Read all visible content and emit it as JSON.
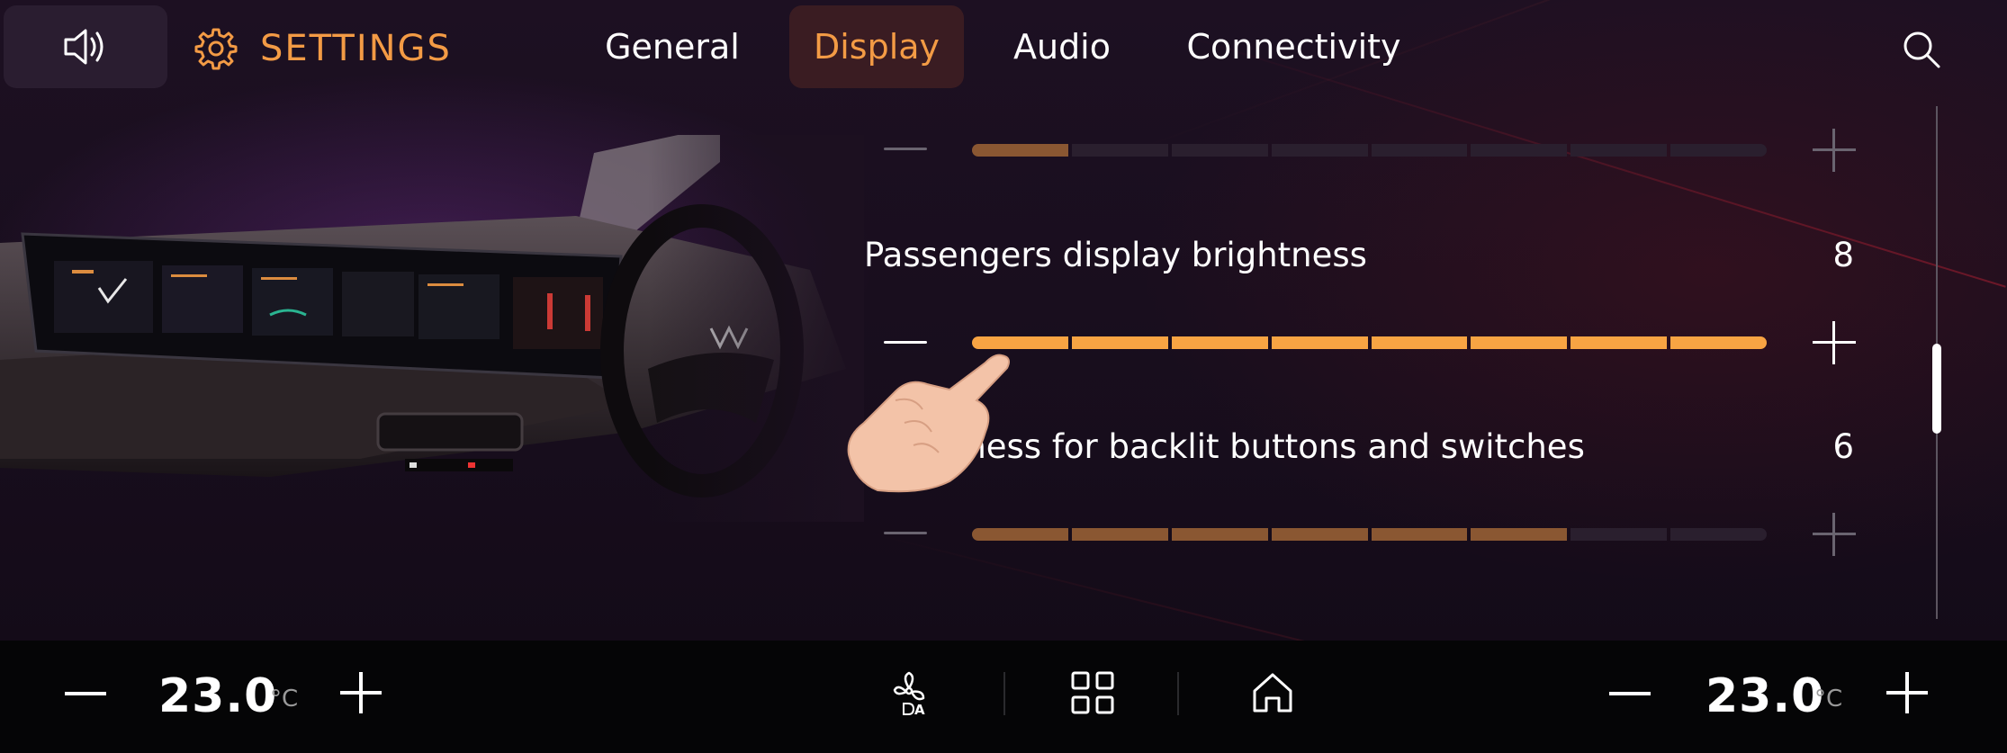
{
  "header": {
    "title": "SETTINGS",
    "tabs": [
      {
        "label": "General",
        "active": false
      },
      {
        "label": "Display",
        "active": true
      },
      {
        "label": "Audio",
        "active": false
      },
      {
        "label": "Connectivity",
        "active": false
      }
    ],
    "icons": {
      "volume": "volume-icon",
      "settings": "gear-icon",
      "search": "search-icon"
    }
  },
  "settings": {
    "rows": [
      {
        "label": "",
        "value": "",
        "level": 1,
        "max": 8
      },
      {
        "label": "Passengers display brightness",
        "value": "8",
        "level": 8,
        "max": 8
      },
      {
        "label": "Brightness for backlit buttons and switches",
        "value": "6",
        "level": 6,
        "max": 8
      }
    ]
  },
  "bottom_bar": {
    "left_temp": "23.0",
    "left_unit": "°C",
    "right_temp": "23.0",
    "right_unit": "°C",
    "icons": [
      "fan-auto-icon",
      "apps-grid-icon",
      "home-icon"
    ]
  },
  "colors": {
    "accent": "#f39b45",
    "slider_active": "#f8a443",
    "slider_dim": "#8a5732",
    "slider_off": "#2a1f2e"
  }
}
